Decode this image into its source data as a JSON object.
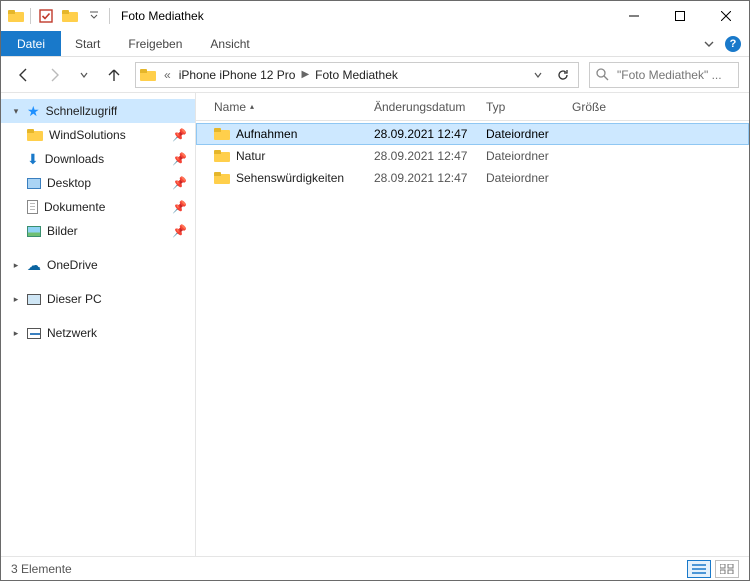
{
  "window": {
    "title": "Foto Mediathek"
  },
  "ribbon": {
    "file": "Datei",
    "tabs": [
      "Start",
      "Freigeben",
      "Ansicht"
    ]
  },
  "address": {
    "crumbs": [
      "iPhone iPhone 12 Pro",
      "Foto Mediathek"
    ]
  },
  "search": {
    "placeholder": "\"Foto Mediathek\" ..."
  },
  "sidebar": {
    "quick": {
      "label": "Schnellzugriff"
    },
    "quick_items": [
      {
        "label": "WindSolutions",
        "icon": "folder"
      },
      {
        "label": "Downloads",
        "icon": "download"
      },
      {
        "label": "Desktop",
        "icon": "desktop"
      },
      {
        "label": "Dokumente",
        "icon": "document"
      },
      {
        "label": "Bilder",
        "icon": "pictures"
      }
    ],
    "onedrive": {
      "label": "OneDrive"
    },
    "thispc": {
      "label": "Dieser PC"
    },
    "network": {
      "label": "Netzwerk"
    }
  },
  "columns": {
    "name": "Name",
    "date": "Änderungsdatum",
    "type": "Typ",
    "size": "Größe"
  },
  "items": [
    {
      "name": "Aufnahmen",
      "date": "28.09.2021 12:47",
      "type": "Dateiordner",
      "size": "",
      "selected": true
    },
    {
      "name": "Natur",
      "date": "28.09.2021 12:47",
      "type": "Dateiordner",
      "size": "",
      "selected": false
    },
    {
      "name": "Sehenswürdigkeiten",
      "date": "28.09.2021 12:47",
      "type": "Dateiordner",
      "size": "",
      "selected": false
    }
  ],
  "status": {
    "count_text": "3 Elemente"
  }
}
